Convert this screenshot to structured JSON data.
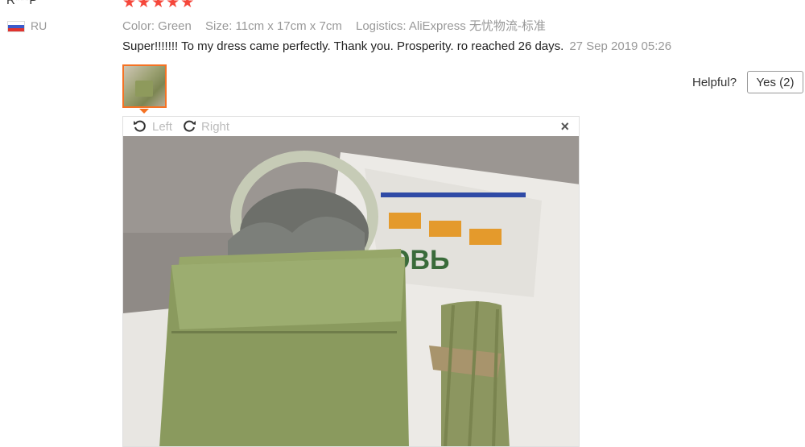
{
  "reviewer": {
    "name": "R***P",
    "country": "RU",
    "flag_icon": "russia-flag-icon"
  },
  "rating": {
    "stars": 5,
    "color": "#f5473b"
  },
  "meta": {
    "color": "Color: Green",
    "size": "Size: 11cm x 17cm x 7cm",
    "logistics": "Logistics: AliExpress 无忧物流-标准"
  },
  "review": {
    "text": "Super!!!!!!! To my dress came perfectly. Thank you. Prosperity. ro reached 26 days.",
    "date": "27 Sep 2019 05:26"
  },
  "helpful": {
    "label": "Helpful?",
    "button": "Yes (2)"
  },
  "viewer": {
    "rotate_left": "Left",
    "rotate_right": "Right",
    "close": "×"
  },
  "colors": {
    "accent": "#f57224",
    "muted": "#999999"
  }
}
